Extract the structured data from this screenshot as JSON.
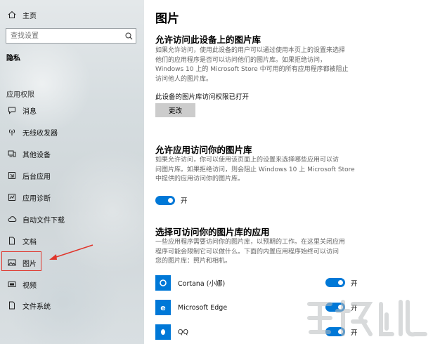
{
  "sidebar": {
    "home_label": "主页",
    "search_placeholder": "查找设置",
    "section_title": "隐私",
    "group_title": "应用权限",
    "items": [
      {
        "label": "消息"
      },
      {
        "label": "无线收发器"
      },
      {
        "label": "其他设备"
      },
      {
        "label": "后台应用"
      },
      {
        "label": "应用诊断"
      },
      {
        "label": "自动文件下载"
      },
      {
        "label": "文档"
      },
      {
        "label": "图片"
      },
      {
        "label": "视频"
      },
      {
        "label": "文件系统"
      }
    ],
    "selected_item": "图片",
    "annotation_color": "#e0352b"
  },
  "main": {
    "title": "图片",
    "section1": {
      "heading": "允许访问此设备上的图片库",
      "desc_lines": [
        "如果允许访问，使用此设备的用户可以通过使用本页上的设置来选择",
        "他们的应用程序是否可以访问他们的图片库。如果拒绝访问，",
        "Windows 10 上的 Microsoft Store 中可用的所有应用程序都被阻止",
        "访问他人的图片库。"
      ],
      "status": "此设备的图片库访问权限已打开",
      "button_label": "更改"
    },
    "section2": {
      "heading": "允许应用访问你的图片库",
      "desc_lines": [
        "如果允许访问，你可以使用该页面上的设置来选择哪些应用可以访",
        "问图片库。如果拒绝访问，则会阻止 Windows 10 上 Microsoft Store",
        "中提供的应用访问你的图片库。"
      ],
      "toggle_state": "开"
    },
    "section3": {
      "heading": "选择可访问你的图片库的应用",
      "desc_lines": [
        "一些应用程序需要访问你的图片库，以预期的工作。在这里关闭应用",
        "程序可能会限制它可以做什么。下面的内置应用程序始终可以访问",
        "您的图片库：照片和相机。"
      ],
      "apps": [
        {
          "name": "Cortana (小娜)",
          "state": "开",
          "icon": "cortana-ring-icon"
        },
        {
          "name": "Microsoft Edge",
          "state": "开",
          "icon": "edge-e-icon"
        },
        {
          "name": "QQ",
          "state": "开",
          "icon": "qq-penguin-icon"
        }
      ]
    },
    "accent_color": "#0078d7"
  }
}
